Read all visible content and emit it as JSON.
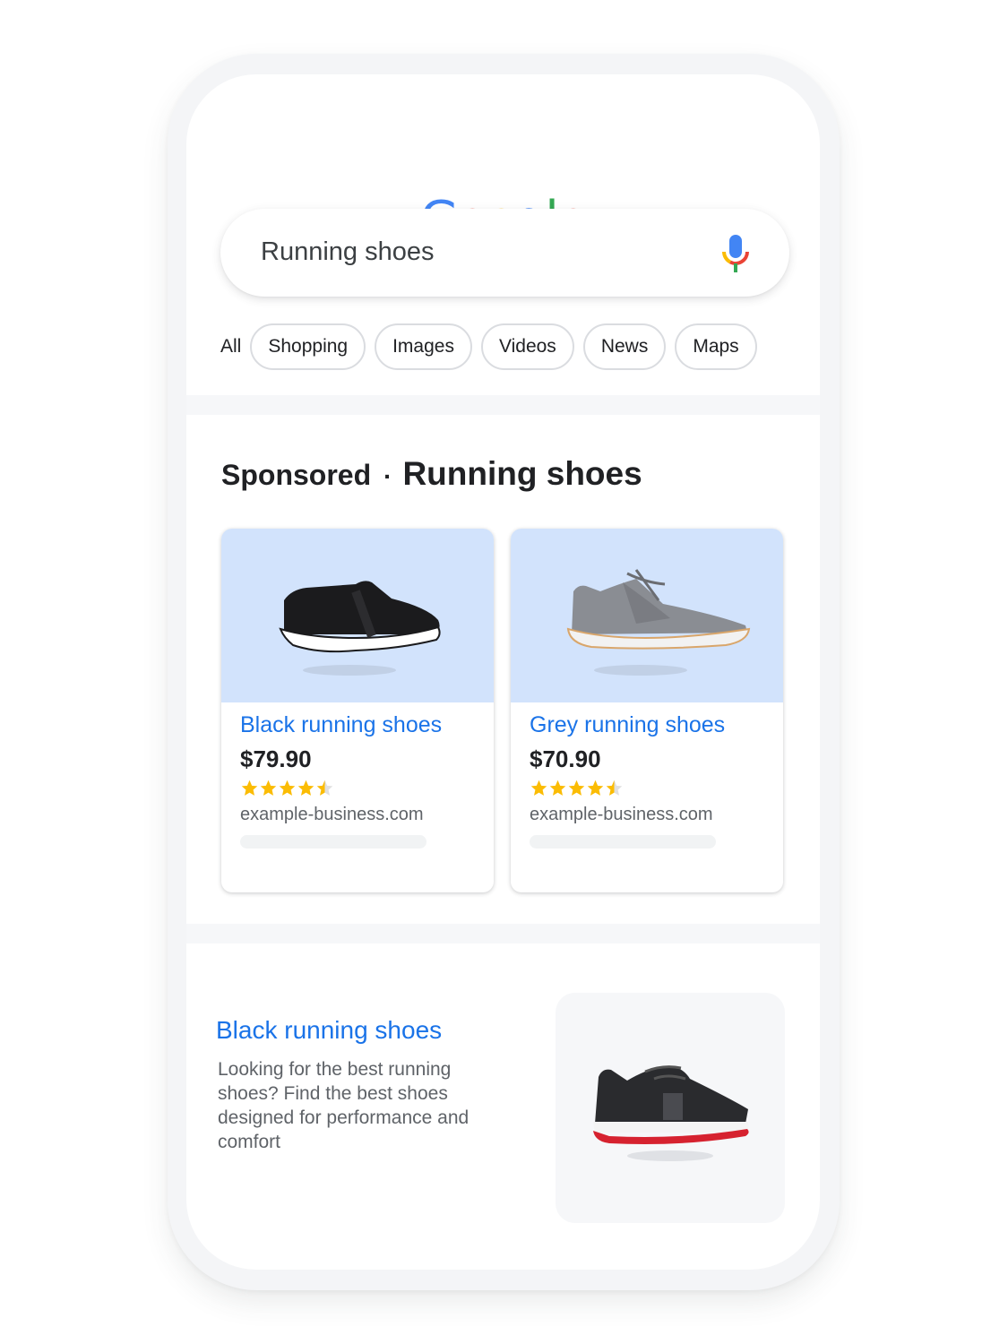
{
  "logo": {
    "text": "Google",
    "letters": [
      {
        "char": "G",
        "color": "#4285f4"
      },
      {
        "char": "o",
        "color": "#ea4335"
      },
      {
        "char": "o",
        "color": "#fbbc05"
      },
      {
        "char": "g",
        "color": "#4285f4"
      },
      {
        "char": "l",
        "color": "#34a853"
      },
      {
        "char": "e",
        "color": "#ea4335"
      }
    ]
  },
  "search": {
    "value": "Running shoes",
    "mic_icon": "microphone-icon"
  },
  "filters": {
    "all_label": "All",
    "chips": [
      "Shopping",
      "Images",
      "Videos",
      "News",
      "Maps"
    ]
  },
  "sponsored": {
    "label": "Sponsored",
    "separator": "·",
    "query": "Running shoes",
    "products": [
      {
        "title": "Black running shoes",
        "price": "$79.90",
        "rating": 4.5,
        "max_rating": 5,
        "domain": "example-business.com",
        "image": "black-slip-on-shoe-image"
      },
      {
        "title": "Grey running shoes",
        "price": "$70.90",
        "rating": 4.5,
        "max_rating": 5,
        "domain": "example-business.com",
        "image": "grey-lace-up-shoe-image"
      }
    ]
  },
  "organic_result": {
    "title": "Black running shoes",
    "description": "Looking for the best running shoes? Find the best shoes designed for performance and comfort",
    "image": "black-red-running-shoe-image"
  },
  "colors": {
    "link_blue": "#1a73e8",
    "card_image_bg": "#d2e3fc",
    "star_gold": "#fbbc04",
    "star_empty": "#e0e0e0"
  }
}
